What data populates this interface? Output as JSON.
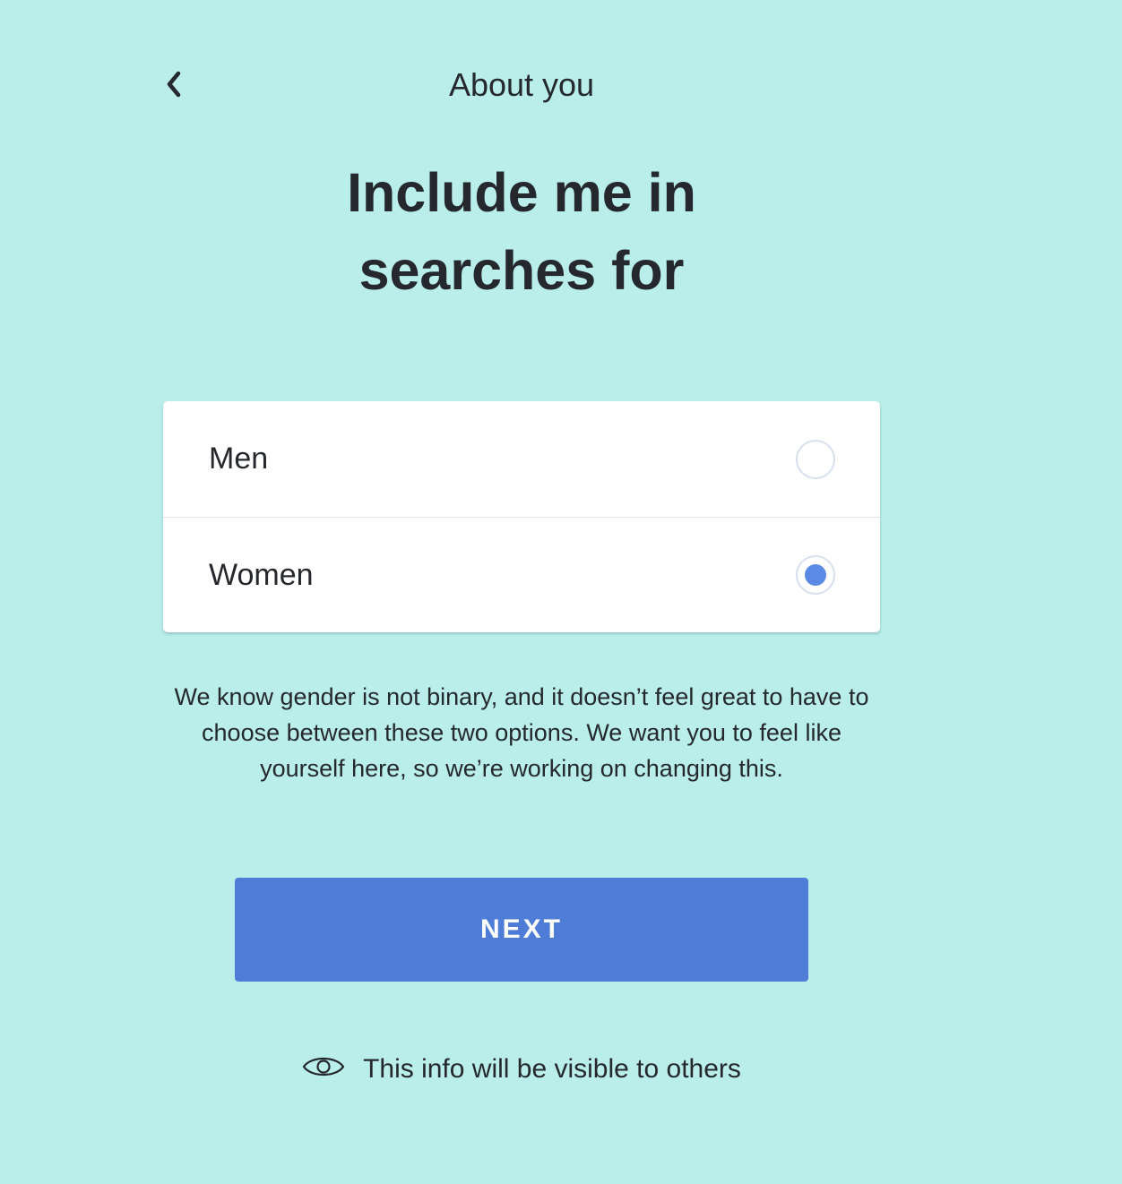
{
  "header": {
    "title": "About you",
    "back_icon": "chevron-left-icon"
  },
  "question": {
    "line1": "Include me in",
    "line2": "searches for"
  },
  "options": [
    {
      "label": "Men",
      "selected": false
    },
    {
      "label": "Women",
      "selected": true
    }
  ],
  "disclaimer": "We know gender is not binary, and it doesn’t feel great to have to choose between these two options. We want you to feel like yourself here, so we’re working on changing this.",
  "next_button": {
    "label": "NEXT"
  },
  "visibility": {
    "icon": "eye-icon",
    "text": "This info will be visible to others"
  },
  "colors": {
    "background": "#b9eeeb",
    "primary": "#4f7cd6",
    "radio_selected": "#5b8ae6",
    "text": "#25282d"
  }
}
